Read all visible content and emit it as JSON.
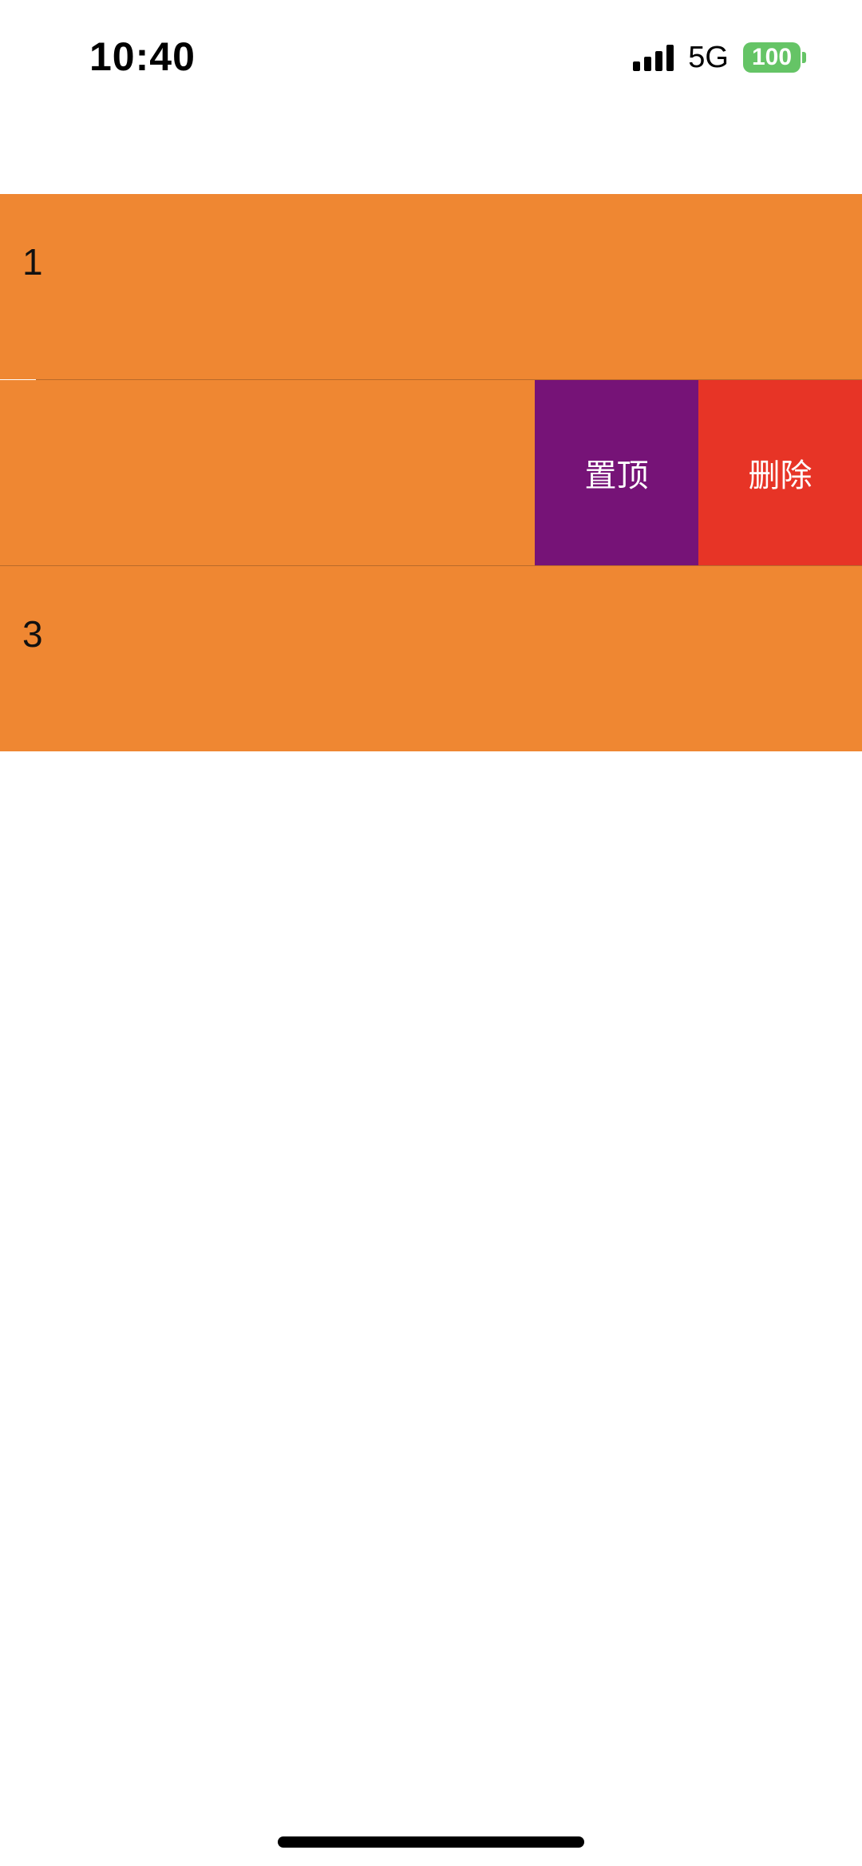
{
  "status_bar": {
    "time": "10:40",
    "network": "5G",
    "battery": "100",
    "battery_color": "#65c466",
    "signal_icon": "cellular-signal-icon"
  },
  "list": {
    "row_color": "#ef8732",
    "rows": [
      {
        "label": "1"
      },
      {
        "label": ""
      },
      {
        "label": "3"
      }
    ],
    "swipe_actions": {
      "pin_label": "置顶",
      "pin_color": "#761377",
      "delete_label": "删除",
      "delete_color": "#e73426"
    }
  }
}
